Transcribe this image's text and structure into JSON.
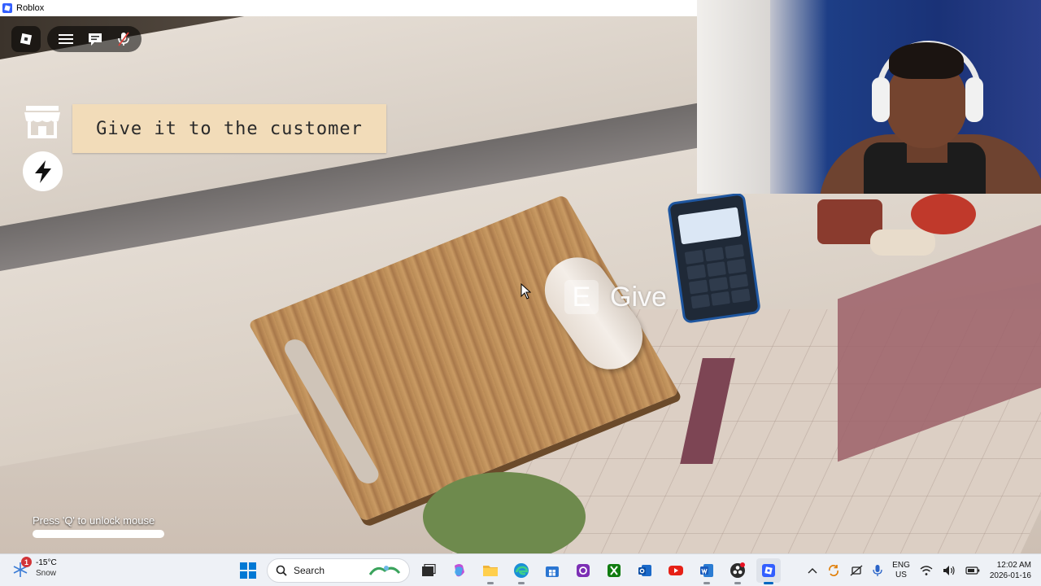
{
  "window": {
    "title": "Roblox"
  },
  "hud": {
    "task_text": "Give it to the customer",
    "interact_key": "E",
    "interact_label": "Give",
    "unlock_hint": "Press 'Q' to unlock mouse"
  },
  "taskbar": {
    "weather": {
      "temp": "-15°C",
      "condition": "Snow",
      "badge": "1"
    },
    "search_label": "Search",
    "lang_line1": "ENG",
    "lang_line2": "US",
    "time": "12:02 AM",
    "date": "2026-01-16"
  },
  "colors": {
    "task_banner_bg": "#f2dcb9",
    "taskbar_bg": "#eef1f6",
    "windows_blue": "#0078d4"
  }
}
